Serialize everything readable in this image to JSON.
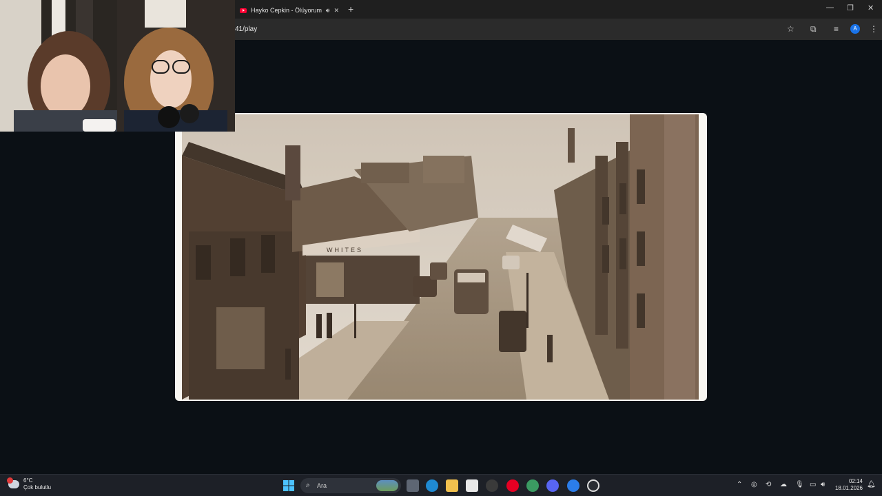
{
  "browser": {
    "tab_title": "Hayko Cepkin - Ölüyorum",
    "url": "41/play"
  },
  "taskbar": {
    "weather_temp": "6°C",
    "weather_desc": "Çok bulutlu",
    "search_label": "Ara",
    "time": "02:14",
    "date": "18.01.2026"
  },
  "photo": {
    "shop_sign": "WHITES"
  },
  "colors": {
    "tab_strip": "#1f1f1f",
    "toolbar": "#2b2b2b",
    "page_bg": "#0b1015",
    "taskbar": "#1d2027",
    "sepia": "#8a7560"
  }
}
